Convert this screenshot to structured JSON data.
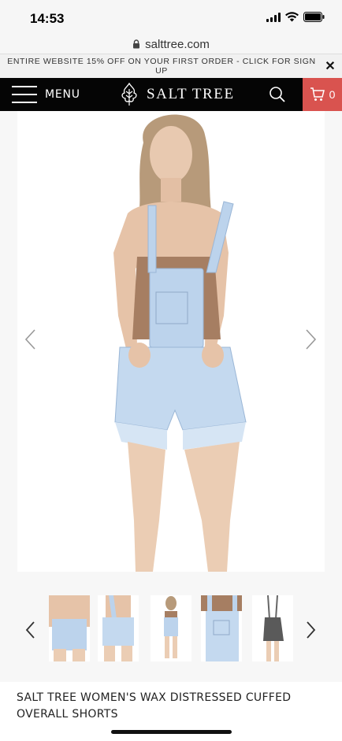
{
  "status_bar": {
    "time": "14:53"
  },
  "browser": {
    "url": "salttree.com"
  },
  "promo": {
    "text": "ENTIRE WEBSITE 15% OFF ON YOUR FIRST ORDER - CLICK FOR SIGN UP",
    "close": "✕"
  },
  "nav": {
    "menu_label": "MENU",
    "logo_text": "SALT TREE",
    "cart_count": "0"
  },
  "product": {
    "title": "SALT TREE WOMEN'S WAX DISTRESSED CUFFED OVERALL SHORTS"
  },
  "colors": {
    "nav_bg": "#050505",
    "cart_bg": "#d9534f",
    "denim": "#bcd3ec"
  },
  "icons": [
    "lock-icon",
    "hamburger-icon",
    "tree-logo-icon",
    "search-icon",
    "cart-icon",
    "chevron-left-icon",
    "chevron-right-icon",
    "close-icon"
  ]
}
